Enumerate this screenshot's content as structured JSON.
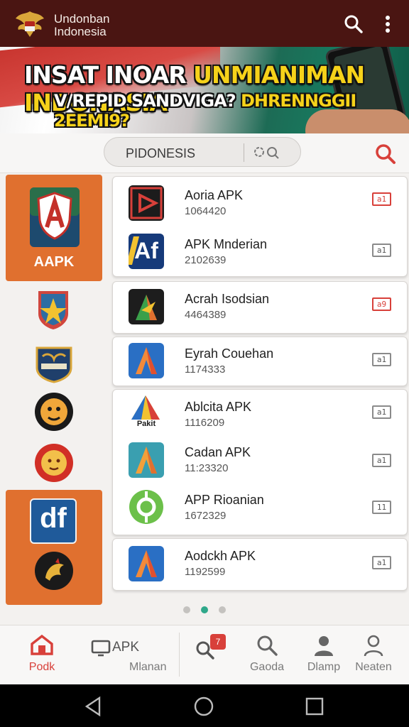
{
  "app": {
    "title_line1": "Undonban",
    "title_line2": "Indonesia"
  },
  "banner": {
    "title_white": "INSAT INOAR ",
    "title_yellow": "UNMIANIMAN INDONASIA",
    "sub_white": "V/REPID SANDVIGA? ",
    "sub_yellow": "DHRENNGGII 2EEMI9?"
  },
  "search": {
    "value": "PIDONESIS"
  },
  "sidebar": {
    "featured_label": "AAPK"
  },
  "apps": [
    {
      "name": "Aoria APK",
      "count": "1064420",
      "badge": "a1",
      "badge_red": true
    },
    {
      "name": "APK Mnderian",
      "count": "2102639",
      "badge": "a1",
      "badge_red": false
    },
    {
      "name": "Acrah Isodsian",
      "count": "4464389",
      "badge": "a9",
      "badge_red": true
    },
    {
      "name": "Eyrah Couehan",
      "count": "1174333",
      "badge": "a1",
      "badge_red": false
    },
    {
      "name": "Ablcita APK",
      "count": "1116209",
      "badge": "a1",
      "badge_red": false
    },
    {
      "name": "Cadan APK",
      "count": "11:23320",
      "badge": "a1",
      "badge_red": false
    },
    {
      "name": "APP Rioanian",
      "count": "1672329",
      "badge": "11",
      "badge_red": false
    },
    {
      "name": "Aodckh APK",
      "count": "1192599",
      "badge": "a1",
      "badge_red": false
    }
  ],
  "icons": {
    "af_text": "Af",
    "df_text": "df",
    "pakit_text": "Pakit"
  },
  "nav": {
    "home": "Podk",
    "apk_top": "APK",
    "apk_bottom": "Mlanan",
    "notif_count": "7",
    "search": "Gaoda",
    "profile": "Dlamp",
    "account": "Neaten"
  },
  "colors": {
    "topbar": "#4a1512",
    "accent_orange": "#e0702f",
    "accent_red": "#d8403a",
    "dot_active": "#2fa88a"
  }
}
